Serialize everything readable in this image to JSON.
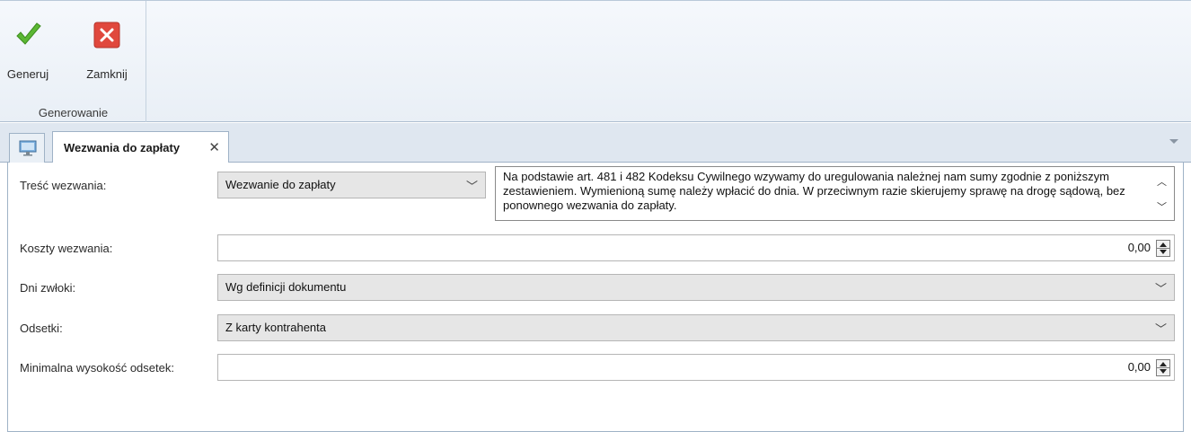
{
  "ribbon": {
    "generate_label": "Generuj",
    "close_label": "Zamknij",
    "group_label": "Generowanie"
  },
  "tabs": {
    "active_label": "Wezwania do zapłaty",
    "close_glyph": "✕"
  },
  "form": {
    "tresc": {
      "label": "Treść wezwania:",
      "value": "Wezwanie do zapłaty",
      "text": "Na podstawie art. 481 i 482 Kodeksu Cywilnego wzywamy do uregulowania należnej nam sumy zgodnie z poniższym zestawieniem. Wymienioną sumę należy wpłacić do dnia. W przeciwnym razie skierujemy sprawę na drogę sądową, bez ponownego wezwania do zapłaty."
    },
    "koszty": {
      "label": "Koszty wezwania:",
      "value": "0,00"
    },
    "dni": {
      "label": "Dni zwłoki:",
      "value": "Wg definicji dokumentu"
    },
    "odsetki": {
      "label": "Odsetki:",
      "value": "Z karty kontrahenta"
    },
    "min_odsetki": {
      "label": "Minimalna wysokość odsetek:",
      "value": "0,00"
    }
  },
  "colors": {
    "accept_green": "#4caf2a",
    "close_red": "#d9443a"
  },
  "icons": {
    "generate": "checkmark-icon",
    "close": "close-x-icon",
    "home_tab": "desktop-icon",
    "dropdown": "chevron-down-icon",
    "spinner": "spinner-arrows-icon"
  }
}
